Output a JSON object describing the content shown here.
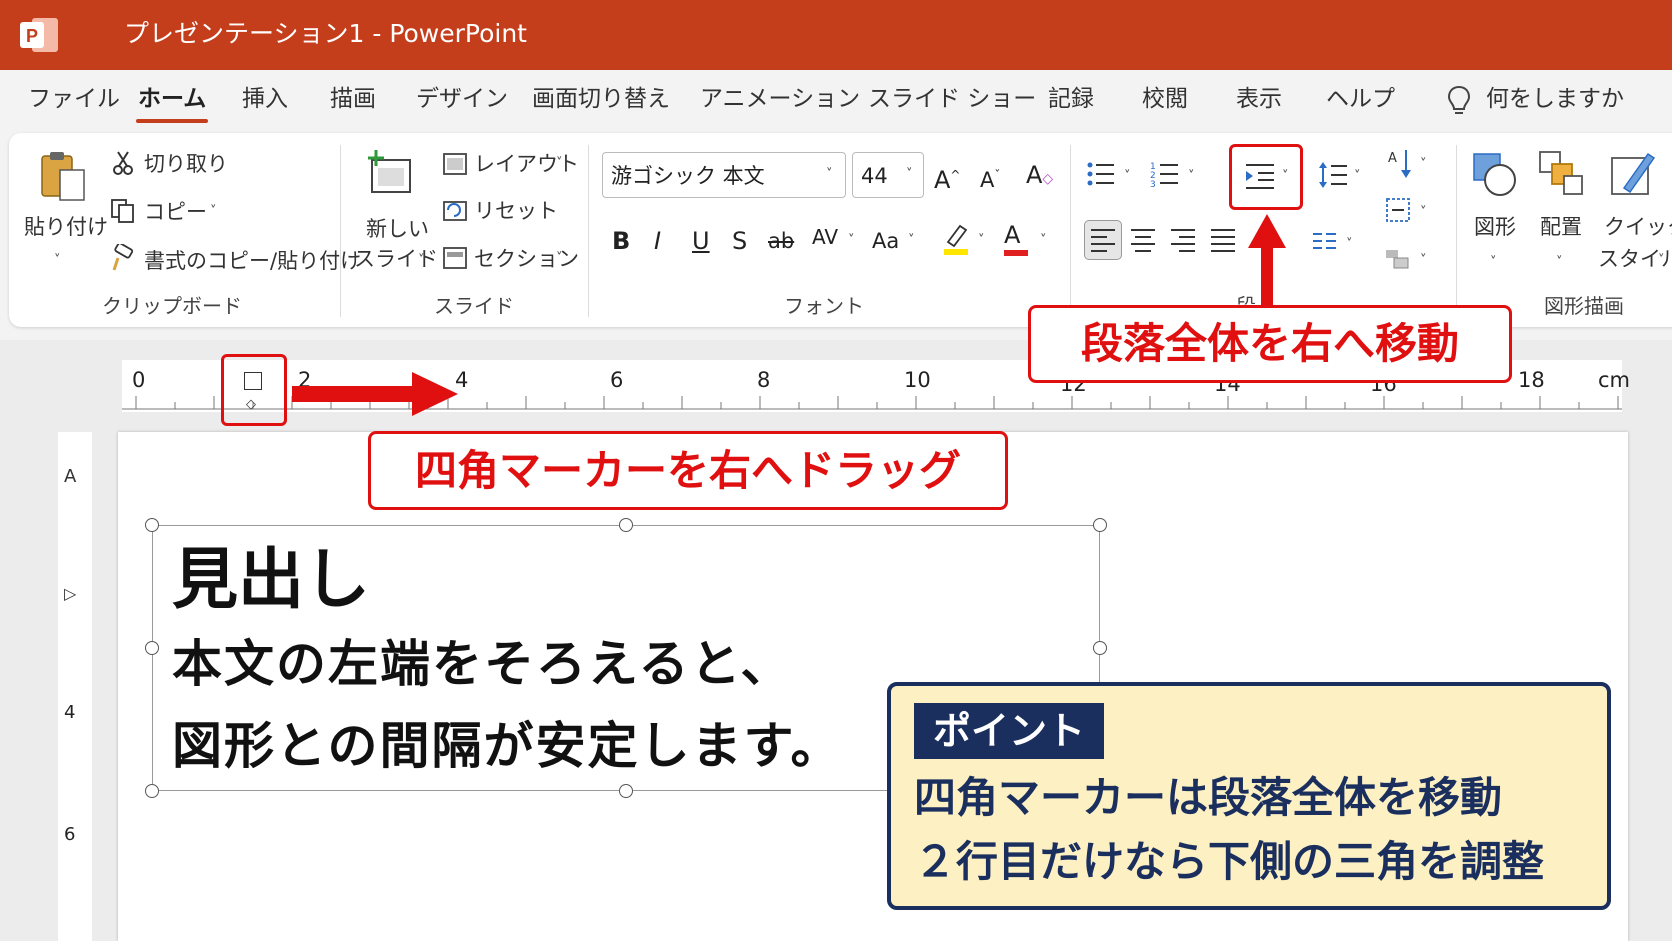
{
  "app": {
    "title": "プレゼンテーション1  -  PowerPoint"
  },
  "menu": {
    "tabs": [
      "ファイル",
      "ホーム",
      "挿入",
      "描画",
      "デザイン",
      "画面切り替え",
      "アニメーション",
      "スライド ショー",
      "記録",
      "校閲",
      "表示",
      "ヘルプ"
    ],
    "active_tab": "ホーム",
    "tell_me": "何をしますか"
  },
  "ribbon": {
    "clipboard": {
      "paste": "貼り付け",
      "cut": "切り取り",
      "copy": "コピー",
      "format_painter": "書式のコピー/貼り付け",
      "label": "クリップボード"
    },
    "slides": {
      "new_slide_1": "新しい",
      "new_slide_2": "スライド",
      "layout": "レイアウト",
      "reset": "リセット",
      "section": "セクション",
      "label": "スライド"
    },
    "font": {
      "font_name": "游ゴシック 本文",
      "font_size": "44",
      "label": "フォント",
      "bold": "B",
      "italic": "I",
      "underline": "U",
      "shadow": "S",
      "strike": "ab",
      "spacing": "AV",
      "case": "Aa"
    },
    "paragraph": {
      "label_partial": "段"
    },
    "drawing": {
      "shapes": "図形",
      "arrange": "配置",
      "quick_styles_1": "クイック",
      "quick_styles_2": "スタイル",
      "label": "図形描画"
    }
  },
  "ruler": {
    "h_ticks": [
      "0",
      "2",
      "4",
      "6",
      "8",
      "10",
      "12",
      "14",
      "16",
      "18"
    ],
    "unit": "cm",
    "v_ticks": [
      "4",
      "6"
    ]
  },
  "slide": {
    "heading": "見出し",
    "body_line1": "本文の左端をそろえると、",
    "body_line2": "図形との間隔が安定します。"
  },
  "callouts": {
    "indent_button": "段落全体を右へ移動",
    "ruler_marker": "四角マーカーを右へドラッグ"
  },
  "point": {
    "tag": "ポイント",
    "line1": "四角マーカーは段落全体を移動",
    "line2": "２行目だけなら下側の三角を調整"
  },
  "colors": {
    "brand": "#c43e1c",
    "callout_red": "#e01010",
    "point_navy": "#1a2f5e",
    "point_bg": "#fdf0c2"
  }
}
